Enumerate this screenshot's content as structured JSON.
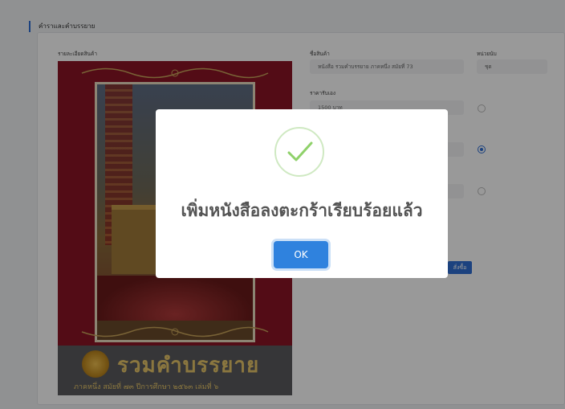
{
  "breadcrumb": "คำราและคำบรรยาย",
  "detail_label": "รายละเอียดสินค้า",
  "product": {
    "name_label": "ชื่อสินค้า",
    "name_value": "หนังสือ รวมคำบรรยาย ภาคหนึ่ง สมัยที่ 73",
    "unit_label": "หน่วยนับ",
    "unit_value": "ชุด",
    "price_label": "ราคารับเอง",
    "price_value": "1500 บาท"
  },
  "order_button": "สั่งซื้อ",
  "cover": {
    "title": "รวมคำบรรยาย",
    "subtitle": "ภาคหนึ่ง สมัยที่ ๗๓ ปีการศึกษา ๒๕๖๓ เล่มที่ ๖"
  },
  "modal": {
    "message": "เพิ่มหนังสือลงตะกร้าเรียบร้อยแล้ว",
    "ok_label": "OK",
    "icon": "check-icon"
  },
  "colors": {
    "accent": "#2f82de",
    "success": "#8fd16a",
    "cover_red": "#8b1526",
    "gold": "#e8c76a"
  }
}
